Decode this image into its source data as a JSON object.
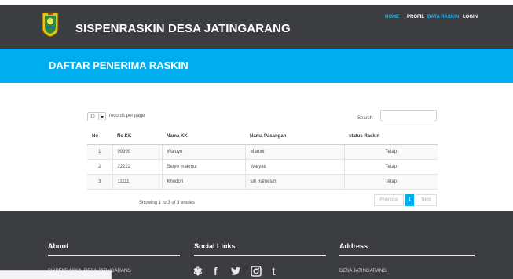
{
  "header": {
    "brand": "SISPENRASKIN DESA JATINGARANG",
    "logo_icon": "regional-coat-of-arms",
    "nav": [
      {
        "label": "HOME",
        "active": true
      },
      {
        "label": "PROFIL",
        "active": false
      },
      {
        "label": "DATA RASKIN",
        "active": true
      },
      {
        "label": "LOGIN",
        "active": false
      }
    ]
  },
  "banner": {
    "title": "DAFTAR PENERIMA RASKIN"
  },
  "table_controls": {
    "page_length": "10",
    "records_per_page_label": "records per page",
    "search_label": "Search:",
    "search_value": ""
  },
  "table": {
    "columns": [
      "No",
      "No KK",
      "Nama KK",
      "Nama Pasangan",
      "status Raskin"
    ],
    "rows": [
      [
        "1",
        "99999",
        "Waluyo",
        "Martini",
        "Tetap"
      ],
      [
        "2",
        "22222",
        "Setyo makmur",
        "Waryati",
        "Tetap"
      ],
      [
        "3",
        "11111",
        "Khodori",
        "siti Ramelah",
        "Tetap"
      ]
    ]
  },
  "pagination": {
    "info": "Showing 1 to 3 of 3 entries",
    "previous": "Previous",
    "current": "1",
    "next": "Next"
  },
  "footer": {
    "about": {
      "heading": "About",
      "text": "SISPENRASKIN DESA JATINGARANG"
    },
    "social": {
      "heading": "Social Links",
      "icons": [
        "dribbble-icon",
        "facebook-icon",
        "twitter-icon",
        "instagram-icon",
        "tumblr-icon"
      ]
    },
    "address": {
      "heading": "Address",
      "text": "DESA JATINGARANG"
    }
  },
  "colors": {
    "navbar": "#3c3d41",
    "accent": "#00aeef",
    "footer": "#3c3d41"
  }
}
